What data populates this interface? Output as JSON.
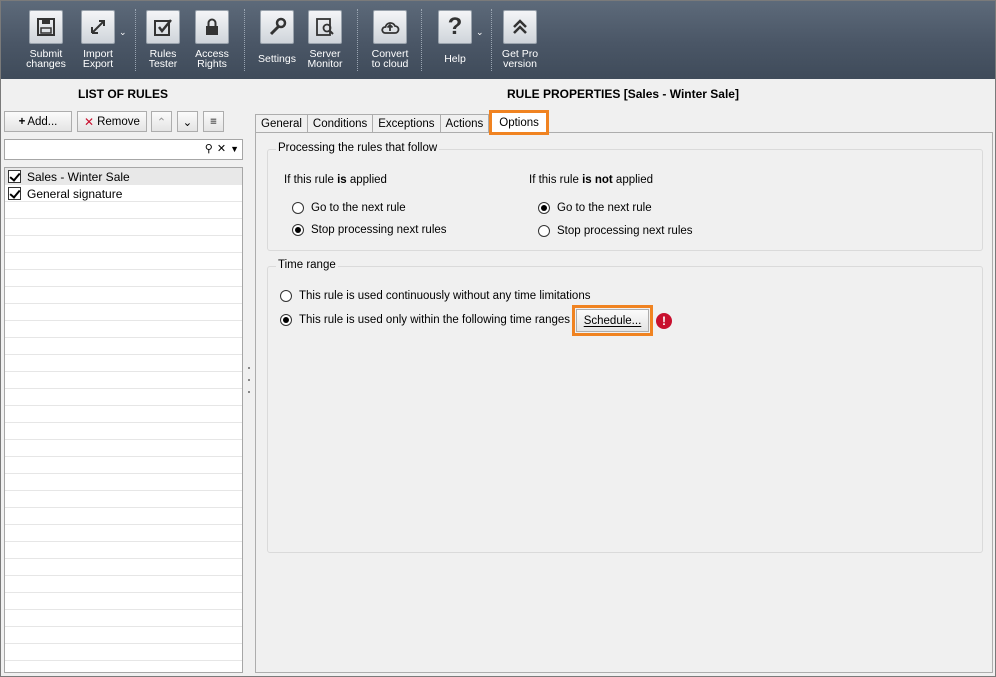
{
  "toolbar": {
    "buttons": [
      {
        "label": "Submit\nchanges",
        "icon": "save-icon"
      },
      {
        "label": "Import\nExport",
        "icon": "import-export-icon"
      },
      {
        "label": "Rules\nTester",
        "icon": "checkbox-icon"
      },
      {
        "label": "Access\nRights",
        "icon": "lock-icon"
      },
      {
        "label": "Settings",
        "icon": "wrench-icon"
      },
      {
        "label": "Server\nMonitor",
        "icon": "monitor-search-icon"
      },
      {
        "label": "Convert\nto cloud",
        "icon": "cloud-icon"
      },
      {
        "label": "Help",
        "icon": "question-icon"
      },
      {
        "label": "Get Pro\nversion",
        "icon": "upgrade-icon"
      }
    ]
  },
  "left_panel": {
    "title": "LIST OF RULES",
    "add_label": "Add...",
    "remove_label": "Remove",
    "search_placeholder": "",
    "rules": [
      {
        "name": "Sales - Winter Sale",
        "checked": true
      },
      {
        "name": "General signature",
        "checked": true
      }
    ]
  },
  "right_panel": {
    "title": "RULE PROPERTIES [Sales - Winter Sale]",
    "tabs": [
      "General",
      "Conditions",
      "Exceptions",
      "Actions",
      "Options"
    ],
    "active_tab": "Options",
    "processing": {
      "group_title": "Processing the rules that follow",
      "applied_prefix": "If this rule ",
      "applied_bold": "is",
      "applied_suffix": " applied",
      "not_applied_prefix": "If this rule ",
      "not_applied_bold": "is not",
      "not_applied_suffix": " applied",
      "applied_options": [
        "Go to the next rule",
        "Stop processing next rules"
      ],
      "applied_selected": "Stop processing next rules",
      "not_applied_options": [
        "Go to the next rule",
        "Stop processing next rules"
      ],
      "not_applied_selected": "Go to the next rule"
    },
    "time_range": {
      "group_title": "Time range",
      "options": [
        "This rule is used continuously without any time limitations",
        "This rule is used only within the following time ranges"
      ],
      "selected": "This rule is used only within the following time ranges",
      "schedule_label": "Schedule...",
      "warning_symbol": "!"
    }
  },
  "colors": {
    "toolbar_bg": "#4a5666",
    "highlight": "#f08321",
    "remove_icon": "#c8102e",
    "warning": "#c8102e"
  }
}
